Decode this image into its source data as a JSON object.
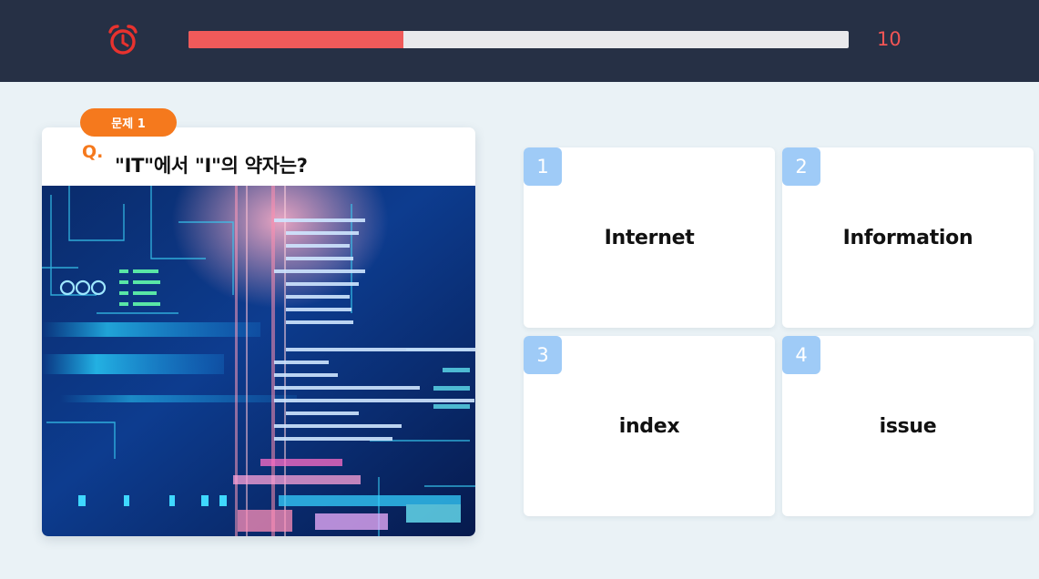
{
  "timer": {
    "count": "10",
    "progress_fraction": 0.325
  },
  "question": {
    "badge": "문제 1",
    "prefix": "Q.",
    "text": "\"IT\"에서 \"I\"의 약자는?",
    "image_icon": "code-screen-image"
  },
  "answers": [
    {
      "number": "1",
      "label": "Internet"
    },
    {
      "number": "2",
      "label": "Information"
    },
    {
      "number": "3",
      "label": "index"
    },
    {
      "number": "4",
      "label": "issue"
    }
  ],
  "colors": {
    "header_bg": "#263045",
    "accent_red": "#f05a5a",
    "accent_orange": "#f5791d",
    "number_badge": "#9fcbf7",
    "page_bg": "#eaf2f6"
  }
}
